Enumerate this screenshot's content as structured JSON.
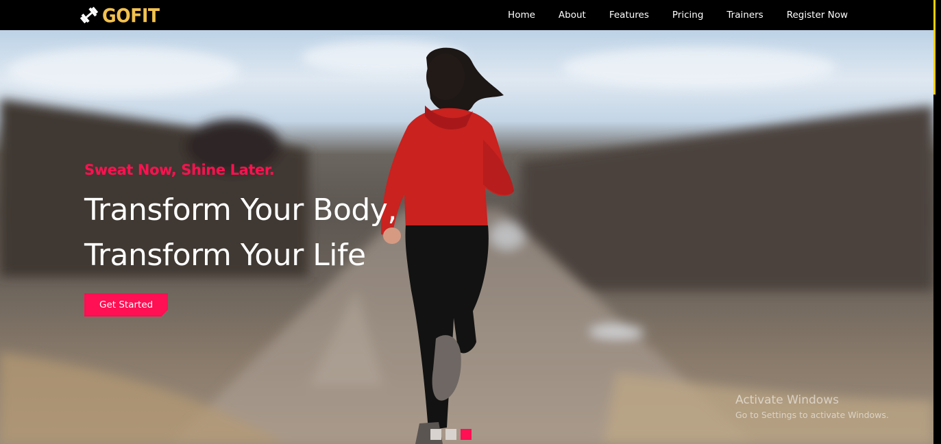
{
  "brand": {
    "name": "GOFIT",
    "logo_icon": "dumbbell-icon",
    "color": "#f2c14e"
  },
  "nav": {
    "items": [
      {
        "label": "Home"
      },
      {
        "label": "About"
      },
      {
        "label": "Features"
      },
      {
        "label": "Pricing"
      },
      {
        "label": "Trainers"
      },
      {
        "label": "Register Now"
      }
    ]
  },
  "hero": {
    "tagline": "Sweat Now, Shine Later.",
    "headline_line1": "Transform Your Body,",
    "headline_line2": "Transform Your Life",
    "cta_label": "Get Started",
    "accent_color": "#ff0f53",
    "slides_total": 3,
    "active_slide": 3
  },
  "os_watermark": {
    "title": "Activate Windows",
    "subtitle": "Go to Settings to activate Windows."
  }
}
